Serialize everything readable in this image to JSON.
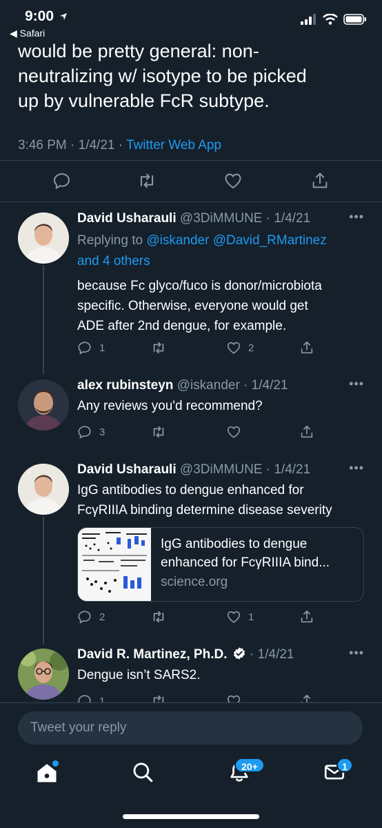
{
  "status": {
    "time": "9:00",
    "back_app": "Safari"
  },
  "main_tweet": {
    "text_lines": [
      "would be pretty general: non-",
      "neutralizing w/ isotype to be picked",
      "up by vulnerable FcR subtype."
    ],
    "time": "3:46 PM · 1/4/21 · ",
    "app": "Twitter Web App"
  },
  "tweets": [
    {
      "name": "David Usharauli",
      "handle": "@3DiMMUNE · 1/4/21",
      "reply_prefix": "Replying to ",
      "reply_mentions": "@iskander @David_RMartinez",
      "reply_more": "and 4 others",
      "text_lines": [
        "because Fc glyco/fuco is donor/microbiota",
        "specific. Otherwise, everyone would get",
        "ADE after 2nd dengue, for example."
      ],
      "replies": "1",
      "retweets": "",
      "likes": "2"
    },
    {
      "name": "alex rubinsteyn",
      "handle": "@iskander · 1/4/21",
      "text_lines": [
        "Any reviews you'd recommend?"
      ],
      "replies": "3",
      "retweets": "",
      "likes": ""
    },
    {
      "name": "David Usharauli",
      "handle": "@3DiMMUNE · 1/4/21",
      "text_lines": [
        "IgG antibodies to dengue enhanced for",
        "FcγRIIIA binding determine disease severity"
      ],
      "card": {
        "title_lines": [
          "IgG antibodies to dengue",
          "enhanced for FcγRIIIA bind..."
        ],
        "domain": "science.org"
      },
      "replies": "2",
      "retweets": "",
      "likes": "1"
    },
    {
      "name": "David R. Martinez, Ph.D.",
      "handle": "· 1/4/21",
      "text_lines": [
        "Dengue isn’t SARS2."
      ],
      "replies": "1",
      "retweets": "",
      "likes": ""
    }
  ],
  "more_label": "•••",
  "reply_placeholder": "Tweet your reply",
  "tabs": {
    "home": {
      "icon": "home-icon",
      "has_dot": true
    },
    "search": {
      "icon": "search-icon"
    },
    "notifications": {
      "icon": "bell-icon",
      "badge": "20+"
    },
    "messages": {
      "icon": "mail-icon",
      "badge": "1"
    }
  },
  "colors": {
    "background": "#15202b",
    "accent": "#1d9bf0",
    "muted": "#8899a6",
    "border": "#38444d"
  }
}
